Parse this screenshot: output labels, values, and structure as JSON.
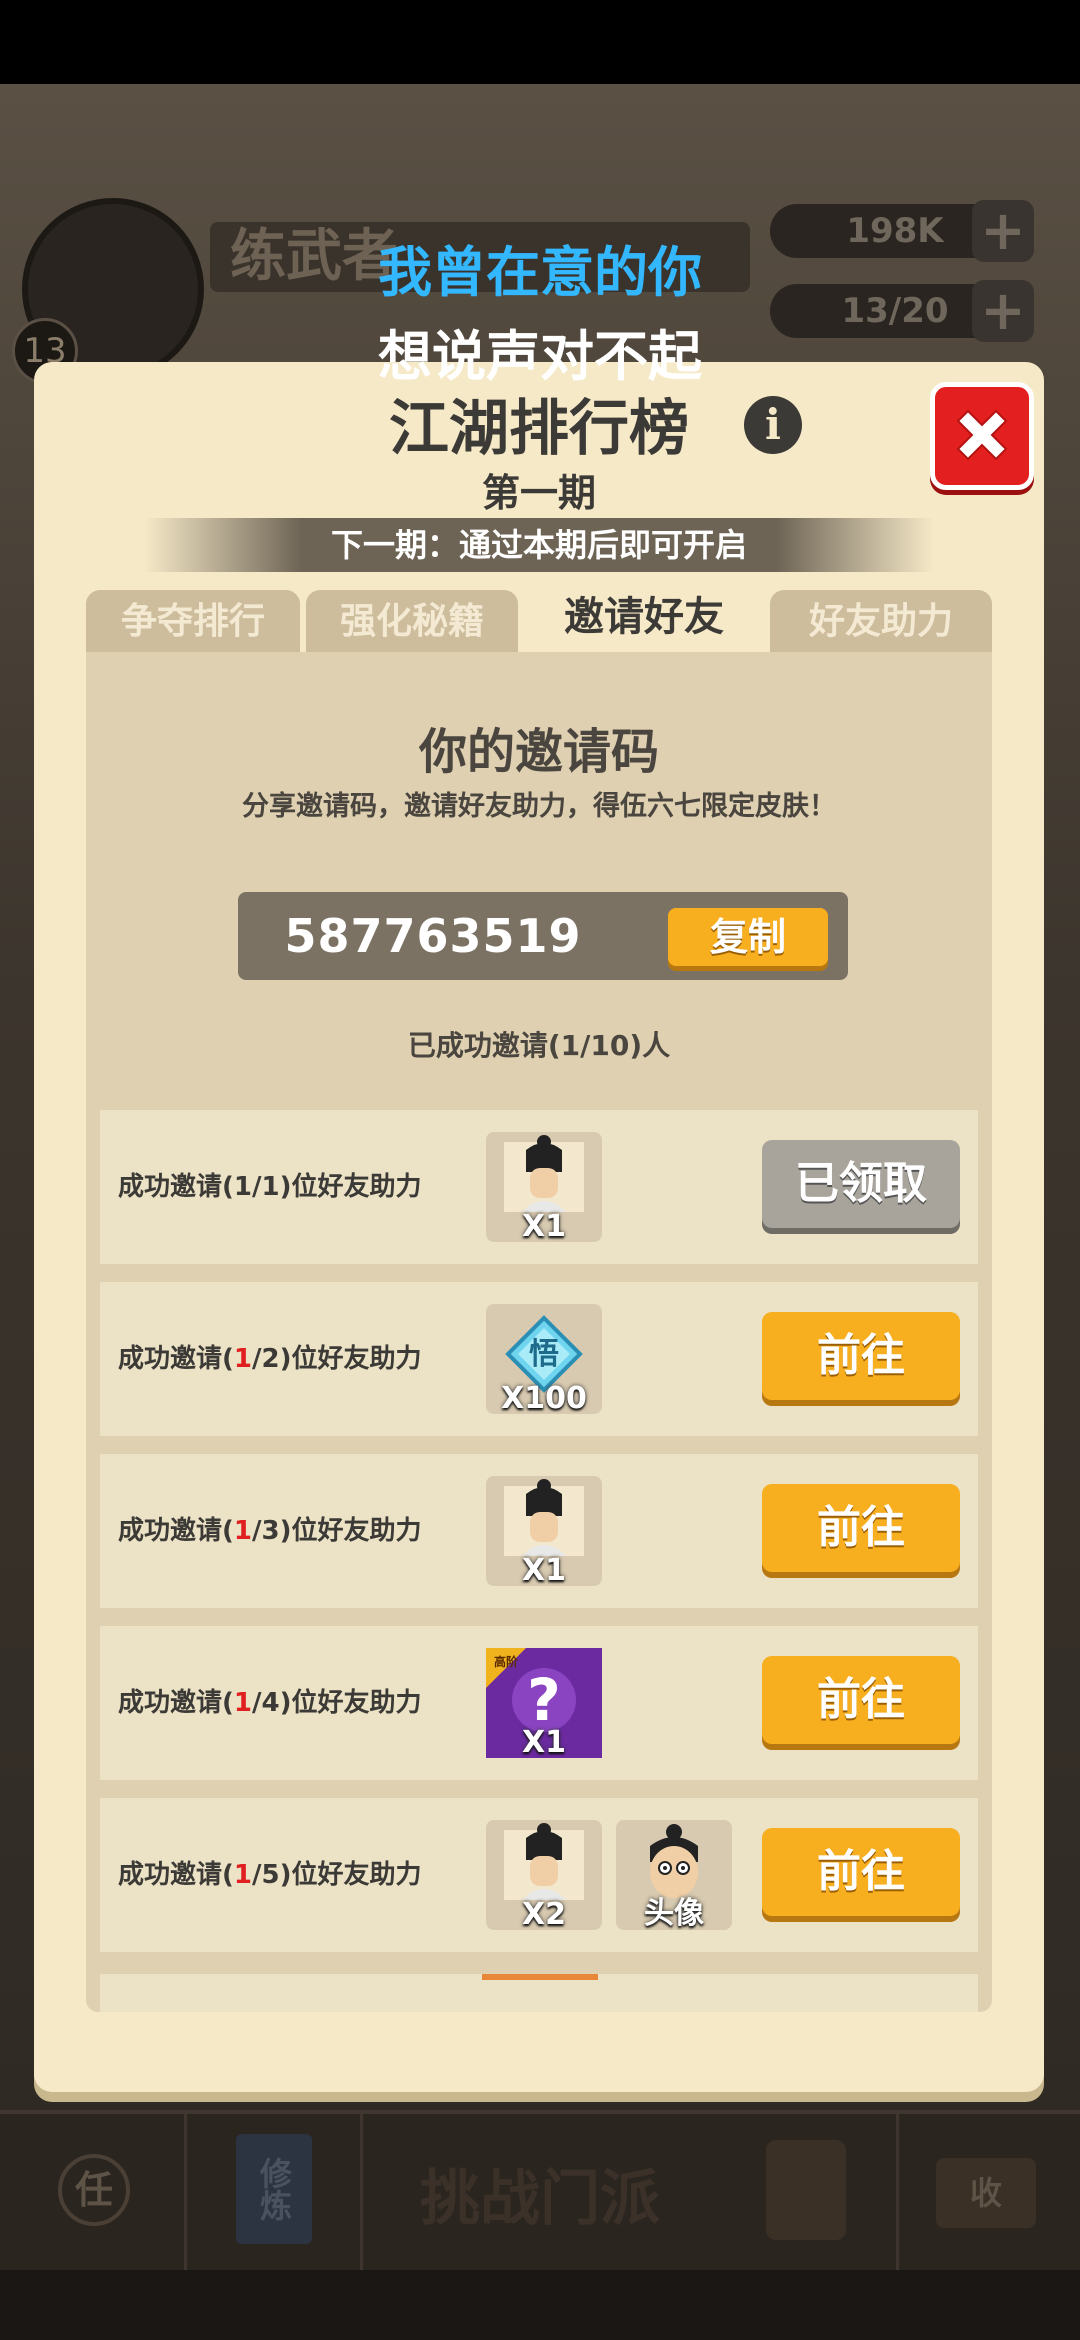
{
  "background": {
    "player_level": "13",
    "player_name": "练武者",
    "coins": "198K",
    "stamina": "13/20",
    "bottom_nav": {
      "task": "任",
      "cultivate": "修炼",
      "challenge": "挑战门派",
      "collect": "收"
    }
  },
  "lyrics": {
    "line1": "我曾在意的你",
    "line2": "想说声对不起"
  },
  "modal": {
    "title": "江湖排行榜",
    "period": "第一期",
    "next_period": "下一期：通过本期后即可开启",
    "tabs": [
      {
        "label": "争夺排行"
      },
      {
        "label": "强化秘籍"
      },
      {
        "label": "邀请好友"
      },
      {
        "label": "好友助力"
      }
    ],
    "active_tab": "邀请好友",
    "invite": {
      "title": "你的邀请码",
      "subtitle": "分享邀请码，邀请好友助力，得伍六七限定皮肤！",
      "code": "587763519",
      "copy_label": "复制",
      "count_text": "已成功邀请(1/10)人"
    },
    "rewards": [
      {
        "prefix": "成功邀请(",
        "done": "1",
        "suffix": "/1)位好友助力",
        "items": [
          {
            "icon": "character-fragment-icon",
            "qty": "X1"
          }
        ],
        "button": "已领取",
        "state": "claimed"
      },
      {
        "prefix": "成功邀请(",
        "done": "1",
        "suffix": "/2)位好友助力",
        "items": [
          {
            "icon": "enlightenment-gem-icon",
            "qty": "X100",
            "glyph": "悟"
          }
        ],
        "button": "前往",
        "state": "go"
      },
      {
        "prefix": "成功邀请(",
        "done": "1",
        "suffix": "/3)位好友助力",
        "items": [
          {
            "icon": "character-fragment-icon",
            "qty": "X1"
          }
        ],
        "button": "前往",
        "state": "go"
      },
      {
        "prefix": "成功邀请(",
        "done": "1",
        "suffix": "/4)位好友助力",
        "items": [
          {
            "icon": "mystery-box-icon",
            "qty": "X1",
            "tag": "高阶"
          }
        ],
        "button": "前往",
        "state": "go"
      },
      {
        "prefix": "成功邀请(",
        "done": "1",
        "suffix": "/5)位好友助力",
        "items": [
          {
            "icon": "character-fragment-icon",
            "qty": "X2"
          },
          {
            "icon": "avatar-portrait-icon",
            "qty": "头像"
          }
        ],
        "button": "前往",
        "state": "go"
      }
    ],
    "colors": {
      "accent": "#f7ae1f",
      "close": "#e31f1f",
      "panel": "#f6e9c8",
      "lyric": "#33b7ff"
    }
  }
}
